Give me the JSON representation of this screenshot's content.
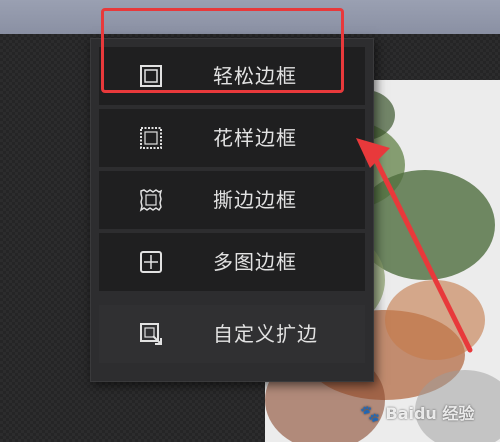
{
  "menu": {
    "items": [
      {
        "label": "轻松边框",
        "icon": "simple-frame-icon"
      },
      {
        "label": "花样边框",
        "icon": "pattern-frame-icon"
      },
      {
        "label": "撕边边框",
        "icon": "torn-edge-frame-icon"
      },
      {
        "label": "多图边框",
        "icon": "multi-image-frame-icon"
      },
      {
        "label": "自定义扩边",
        "icon": "custom-border-extend-icon"
      }
    ]
  },
  "colors": {
    "highlight": "#e8393b",
    "menu_bg": "#1f1f20",
    "menu_text": "#e2e2e2"
  },
  "watermark": {
    "text": "Baidu 经验",
    "logo": "baidu-paw-logo"
  }
}
